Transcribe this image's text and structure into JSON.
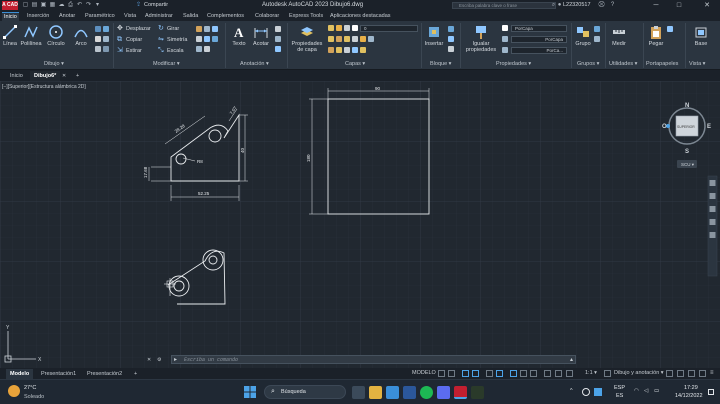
{
  "titlebar": {
    "logo": "A CAD",
    "share": "Compartir",
    "title": "Autodesk AutoCAD 2023  Dibujo6.dwg",
    "search_placeholder": "Escriba palabra clave o frase",
    "user": "L22320517",
    "win_min": "─",
    "win_max": "□",
    "win_close": "✕"
  },
  "menu_tabs": [
    "Inicio",
    "Inserción",
    "Anotar",
    "Paramétrico",
    "Vista",
    "Administrar",
    "Salida",
    "Complementos",
    "Colaborar",
    "Express Tools",
    "Aplicaciones destacadas"
  ],
  "ribbon": {
    "draw": {
      "linea": "Línea",
      "polilinea": "Polilínea",
      "circulo": "Círculo",
      "arco": "Arco",
      "panel": "Dibujo ▾"
    },
    "modify": {
      "desplazar": "Desplazar",
      "girar": "Girar",
      "copiar": "Copiar",
      "simetria": "Simetría",
      "estirar": "Estirar",
      "escala": "Escala",
      "panel": "Modificar ▾"
    },
    "annotation": {
      "texto": "Texto",
      "acotar": "Acotar",
      "panel": "Anotación ▾"
    },
    "layers": {
      "propiedades_line1": "Propiedades",
      "propiedades_line2": "de capa",
      "layer_value": "0",
      "panel": "Capas ▾"
    },
    "block": {
      "insertar": "Insertar",
      "panel": "Bloque ▾"
    },
    "properties": {
      "igualar_line1": "Igualar",
      "igualar_line2": "propiedades",
      "porcapa1": "PorCapa",
      "porcapa2": "PorCapa",
      "porcapa3": "PorCa...",
      "panel": "Propiedades ▾"
    },
    "groups": {
      "grupo": "Grupo",
      "panel": "Grupos ▾"
    },
    "utilities": {
      "medir": "Medir",
      "panel": "Utilidades ▾"
    },
    "clipboard": {
      "pegar": "Pegar",
      "panel": "Portapapeles"
    },
    "view": {
      "base": "Base",
      "panel": "Vista ▾"
    }
  },
  "doc_tabs": {
    "inicio": "Inicio",
    "dibujo": "Dibujo6*",
    "add": "+"
  },
  "viewport": {
    "label": "[−][Superior][Estructura alámbrica 2D]",
    "cube_n": "N",
    "cube_s": "S",
    "cube_e": "E",
    "cube_w": "O",
    "cube_face": "SUPERIOR",
    "wcs": "SCU ▾",
    "axis_x": "X",
    "axis_y": "Y"
  },
  "dims": {
    "d1": "28.28",
    "d2": "7.07",
    "d3": "R8",
    "d4": "40",
    "d5": "17.68",
    "d6": "52.25",
    "rect_w": "90",
    "rect_h": "180"
  },
  "command": {
    "placeholder": "Escriba un comando"
  },
  "layout_tabs": {
    "modelo": "Modelo",
    "p1": "Presentación1",
    "p2": "Presentación2",
    "add": "+"
  },
  "status": {
    "modelo": "MODELO",
    "scale": "1:1 ▾",
    "workspace": "Dibujo y anotación ▾"
  },
  "taskbar": {
    "temp": "27°C",
    "weather": "Soleado",
    "search": "Búsqueda",
    "lang1": "ESP",
    "lang2": "ES",
    "time": "17:29",
    "date": "14/12/2022"
  }
}
